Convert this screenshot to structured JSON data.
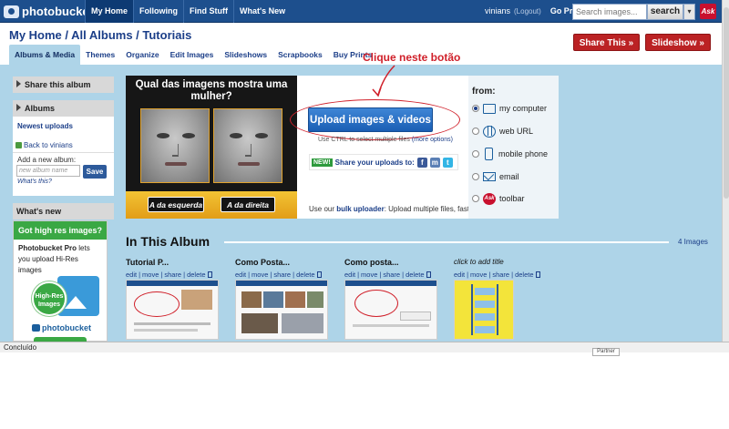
{
  "topnav": {
    "logo_text": "photobucket",
    "links": [
      "My Home",
      "Following",
      "Find Stuff",
      "What's New"
    ],
    "username": "vinians",
    "logout": "(Logout)",
    "gopro": "Go Pro",
    "search_placeholder": "Search images...",
    "search_button": "search",
    "search_dropdown": "▾",
    "ask_label": "Ask"
  },
  "header": {
    "breadcrumb": "My Home / All Albums / Tutoriais",
    "share_button": "Share This »",
    "slideshow_button": "Slideshow »",
    "tabs": [
      "Albums & Media",
      "Themes",
      "Organize",
      "Edit Images",
      "Slideshows",
      "Scrapbooks",
      "Buy Prints"
    ]
  },
  "annotation": {
    "text": "Clique neste botão"
  },
  "sidebar": {
    "share_title": "Share this album",
    "albums_title": "Albums",
    "newest_uploads": "Newest uploads",
    "back_link": "Back to vinians",
    "add_album_label": "Add a new album:",
    "album_name_placeholder": "new album name",
    "save_button": "Save",
    "whats_this": "What's this?",
    "whats_new_title": "What's new"
  },
  "promo": {
    "header": "Got high res images?",
    "text_bold": "Photobucket Pro",
    "text_rest": " lets you upload Hi-Res images",
    "badge": "High-Res Images",
    "logo": "photobucket"
  },
  "quiz": {
    "question": "Qual das imagens mostra uma mulher?",
    "left_button": "A da esquerda",
    "right_button": "A da direita"
  },
  "upload": {
    "button": "Upload images & videos",
    "ctrl_hint": "Use CTRL to select multiple files",
    "more_options": "(more options)",
    "new_badge": "NEW!",
    "share_uploads": "Share your uploads to:",
    "bulk_prefix": "Use our ",
    "bulk_link": "bulk uploader",
    "bulk_suffix": ": Upload multiple files, fast!"
  },
  "from": {
    "title": "from:",
    "options": [
      "my computer",
      "web URL",
      "mobile phone",
      "email",
      "toolbar"
    ],
    "selected": "my computer"
  },
  "album": {
    "title": "In This Album",
    "count": "4 Images",
    "actions": [
      "edit",
      "move",
      "share",
      "delete"
    ],
    "items": [
      {
        "title": "Tutorial P...",
        "italic": false
      },
      {
        "title": "Como Posta...",
        "italic": false
      },
      {
        "title": "Como posta...",
        "italic": false
      },
      {
        "title": "click to add title",
        "italic": true
      }
    ]
  },
  "statusbar": {
    "text": "Concluído",
    "tooltip": "Partner"
  },
  "colors": {
    "nav_blue": "#1d4f8d",
    "link_blue": "#1b3e88",
    "panel_bg": "#aed4e8",
    "red_button": "#bb2224",
    "promo_green": "#3aa844",
    "annotation_red": "#d0202a"
  }
}
